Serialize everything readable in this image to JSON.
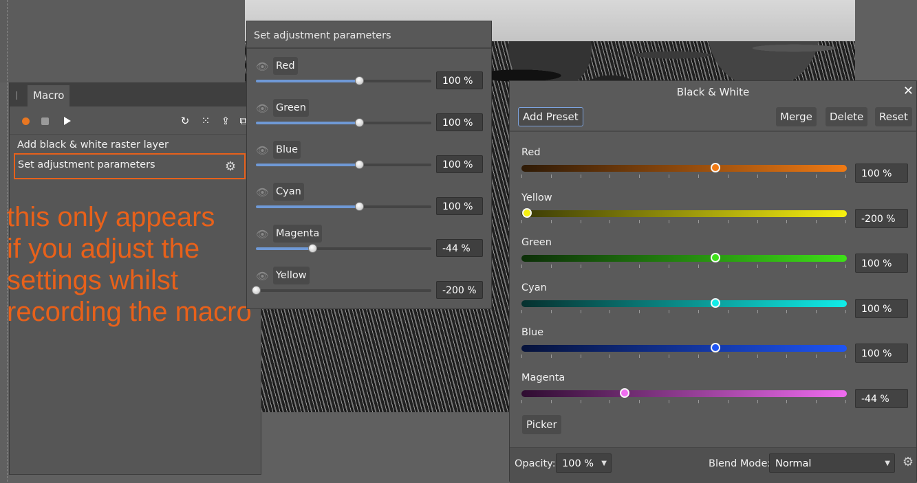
{
  "macro_panel": {
    "tab_label": "Macro",
    "toolbar_icons": [
      "record-icon",
      "stop-icon",
      "play-icon",
      "reset-icon",
      "grid-icon",
      "export-icon",
      "copy-icon"
    ],
    "steps": [
      {
        "label": "Add black & white raster layer"
      },
      {
        "label": "Set adjustment parameters",
        "selected": true
      }
    ],
    "annotation": "this only appears\nif you adjust the\nsettings whilst\nrecording the macro"
  },
  "params_panel": {
    "title": "Set adjustment parameters",
    "rows": [
      {
        "label": "Red",
        "value": "100 %",
        "level": 0.59
      },
      {
        "label": "Green",
        "value": "100 %",
        "level": 0.59
      },
      {
        "label": "Blue",
        "value": "100 %",
        "level": 0.59
      },
      {
        "label": "Cyan",
        "value": "100 %",
        "level": 0.59
      },
      {
        "label": "Magenta",
        "value": "-44 %",
        "level": 0.32
      },
      {
        "label": "Yellow",
        "value": "-200 %",
        "level": 0.0
      }
    ]
  },
  "bw_panel": {
    "title": "Black & White",
    "buttons": {
      "add_preset": "Add Preset",
      "merge": "Merge",
      "delete": "Delete",
      "reset": "Reset",
      "picker": "Picker"
    },
    "sliders": [
      {
        "label": "Red",
        "value": "100 %",
        "level": 0.597,
        "color_dark": "#2e1a06",
        "color_bright": "#f07a14"
      },
      {
        "label": "Yellow",
        "value": "-200 %",
        "level": 0.017,
        "color_dark": "#3a3a06",
        "color_bright": "#f7f010"
      },
      {
        "label": "Green",
        "value": "100 %",
        "level": 0.597,
        "color_dark": "#0c2e08",
        "color_bright": "#3ee018"
      },
      {
        "label": "Cyan",
        "value": "100 %",
        "level": 0.597,
        "color_dark": "#06302e",
        "color_bright": "#10ece8"
      },
      {
        "label": "Blue",
        "value": "100 %",
        "level": 0.597,
        "color_dark": "#06123a",
        "color_bright": "#1e54f4"
      },
      {
        "label": "Magenta",
        "value": "-44 %",
        "level": 0.317,
        "color_dark": "#2e0c30",
        "color_bright": "#f06cf0"
      }
    ],
    "footer": {
      "opacity_label": "Opacity:",
      "opacity_value": "100 %",
      "blend_label": "Blend Mode:",
      "blend_value": "Normal"
    }
  },
  "colors": {
    "accent_orange": "#e8611a",
    "slider_blue": "#6f99d6",
    "preset_outline": "#7da4e0"
  }
}
